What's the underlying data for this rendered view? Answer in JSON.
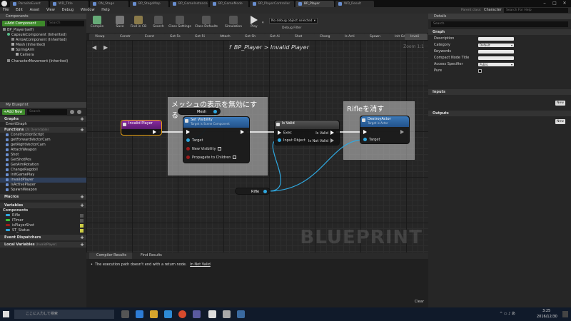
{
  "window_tabs": [
    "ParasiteEvent",
    "WD_Title",
    "ON_Stage",
    "BP_StageMap",
    "BP_GameInstance",
    "BP_GameMode",
    "BP_PlayerController",
    "BP_Player",
    "WD_Result"
  ],
  "window_right": {
    "parent_class_label": "Parent class:",
    "parent_class_value": "Character",
    "help_search_placeholder": "Search For Help"
  },
  "menu": [
    "File",
    "Edit",
    "Asset",
    "View",
    "Debug",
    "Window",
    "Help"
  ],
  "components": {
    "header": "Components",
    "add_button": "+Add Component",
    "search_placeholder": "Search",
    "root": "BP_Player(self)",
    "items": [
      "CapsuleComponent (Inherited)",
      "ArrowComponent (Inherited)",
      "Mesh (Inherited)",
      "SpringArm",
      "Camera",
      "CharacterMovement (Inherited)"
    ]
  },
  "my_blueprint": {
    "header": "My Blueprint",
    "add_new": "+Add New",
    "search_placeholder": "Search",
    "graphs_label": "Graphs",
    "graphs": [
      "EventGraph"
    ],
    "functions_label": "Functions",
    "functions_note": "(24 Overridable)",
    "functions": [
      "ConstructionScript",
      "getForwardVectorCam",
      "getRightVectorCam",
      "AttachWeapon",
      "Shot",
      "GetShotPos",
      "GetAimRotation",
      "ChangeRagdoll",
      "InitGamePlay",
      "InvalidPlayer",
      "isActivePlayer",
      "SpawnWeapon"
    ],
    "macros_label": "Macros",
    "variables_label": "Variables",
    "components_label": "Components",
    "variables": [
      {
        "name": "Rifle",
        "color": "#2fa8e0"
      },
      {
        "name": "ITimer",
        "color": "#3cc43c"
      },
      {
        "name": "isPlayerShot",
        "color": "#9c1b1b"
      },
      {
        "name": "ST_Status",
        "color": "#2fa8e0"
      }
    ],
    "event_dispatchers_label": "Event Dispatchers",
    "local_variables_label": "Local Variables",
    "local_variables_note": "(InvalidPlayer)"
  },
  "toolbar": {
    "buttons": [
      "Compile",
      "Save",
      "Find in CB",
      "Search",
      "Class Settings",
      "Class Defaults",
      "Simulation",
      "Play"
    ],
    "debug_select": "No debug object selected",
    "debug_filter": "Debug Filter"
  },
  "function_tabs": [
    "Viewp",
    "Constr",
    "Event",
    "Get Fo",
    "Get Ri",
    "Attach",
    "Get Sh",
    "Get Ai",
    "Shot",
    "Chang",
    "Is Acti",
    "Spawn",
    "Init Ga",
    "Invali"
  ],
  "graph": {
    "breadcrumb_f": "f",
    "breadcrumb": "BP_Player > Invalid Player",
    "zoom": "Zoom 1:1",
    "watermark": "BLUEPRINT",
    "comment1": "メッシュの表示を無効にする",
    "comment2": "Rifleを消す",
    "entry_node": "Invalid Player",
    "mesh_node": "Mesh",
    "setvis_title": "Set Visibility",
    "setvis_sub": "Target is Scene Component",
    "setvis_pins": [
      "Target",
      "New Visibility",
      "Propagate to Children"
    ],
    "isvalid_title": "Is Valid",
    "isvalid_pins": [
      "Exec",
      "Input Object",
      "Is Valid",
      "Is Not Valid"
    ],
    "destroy_title": "DestroyActor",
    "destroy_sub": "Target is Actor",
    "destroy_pins": [
      "Target"
    ],
    "rifle_node": "Rifle"
  },
  "results": {
    "tabs": [
      "Compiler Results",
      "Find Results"
    ],
    "message": "The execution path doesn't end with a return node.",
    "message_link": "In Not Valid",
    "clear": "Clear"
  },
  "details": {
    "header": "Details",
    "search_placeholder": "Search",
    "graph_label": "Graph",
    "fields": [
      {
        "label": "Description",
        "value": ""
      },
      {
        "label": "Category",
        "value": "Default"
      },
      {
        "label": "Keywords",
        "value": ""
      },
      {
        "label": "Compact Node Title",
        "value": ""
      },
      {
        "label": "Access Specifier",
        "value": "Public"
      },
      {
        "label": "Pure",
        "value": ""
      }
    ],
    "inputs_label": "Inputs",
    "outputs_label": "Outputs",
    "new_label": "New"
  },
  "taskbar": {
    "search_text": "ここに入力して検索",
    "time": "3:25",
    "date": "2016/12/30"
  }
}
